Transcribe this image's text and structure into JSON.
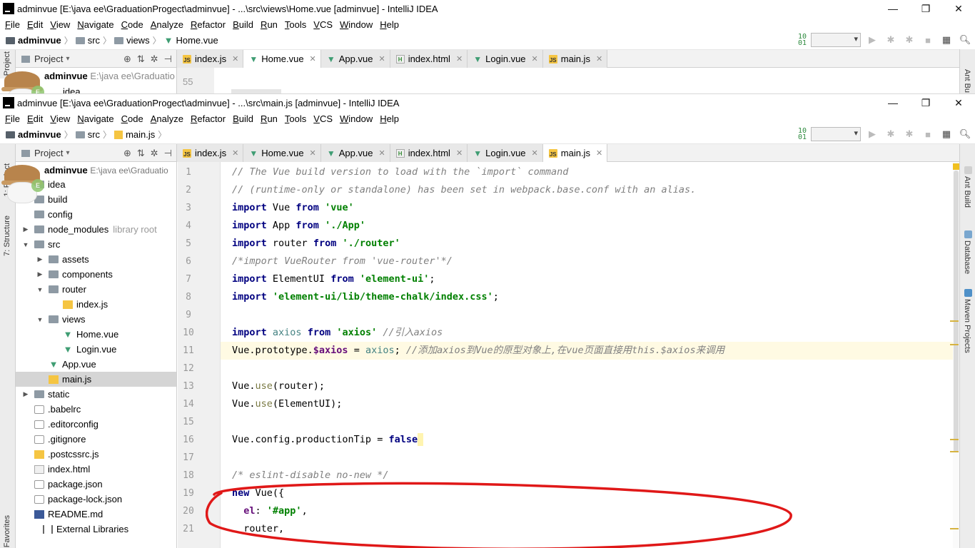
{
  "back_window": {
    "title": "adminvue [E:\\java ee\\GraduationProgect\\adminvue] - ...\\src\\views\\Home.vue [adminvue] - IntelliJ IDEA",
    "menu": [
      "File",
      "Edit",
      "View",
      "Navigate",
      "Code",
      "Analyze",
      "Refactor",
      "Build",
      "Run",
      "Tools",
      "VCS",
      "Window",
      "Help"
    ],
    "breadcrumb": [
      "adminvue",
      "src",
      "views",
      "Home.vue"
    ],
    "project_label": "Project",
    "tabs": [
      "index.js",
      "Home.vue",
      "App.vue",
      "index.html",
      "Login.vue",
      "main.js"
    ],
    "active_tab": "Home.vue",
    "project_root": "adminvue",
    "project_root_path": "E:\\java ee\\Graduatio",
    "first_child": "idea",
    "visible_line": "55",
    "right_label": "Ant Bu"
  },
  "front_window": {
    "title": "adminvue [E:\\java ee\\GraduationProgect\\adminvue] - ...\\src\\main.js [adminvue] - IntelliJ IDEA",
    "menu": [
      "File",
      "Edit",
      "View",
      "Navigate",
      "Code",
      "Analyze",
      "Refactor",
      "Build",
      "Run",
      "Tools",
      "VCS",
      "Window",
      "Help"
    ],
    "breadcrumb": [
      "adminvue",
      "src",
      "main.js"
    ],
    "project_label": "Project",
    "tabs": [
      {
        "label": "index.js",
        "type": "js"
      },
      {
        "label": "Home.vue",
        "type": "vue"
      },
      {
        "label": "App.vue",
        "type": "vue"
      },
      {
        "label": "index.html",
        "type": "html"
      },
      {
        "label": "Login.vue",
        "type": "vue"
      },
      {
        "label": "main.js",
        "type": "js"
      }
    ],
    "active_tab": "main.js",
    "left_stripe": {
      "project": "1: Project",
      "structure": "7: Structure",
      "favorites": "2: Favorites"
    },
    "right_stripe": {
      "ant": "Ant Build",
      "database": "Database",
      "maven": "Maven Projects"
    },
    "project_root": "adminvue",
    "project_root_path": "E:\\java ee\\Graduatio",
    "tree": [
      {
        "label": "idea",
        "type": "folder",
        "depth": 1,
        "arrow": ""
      },
      {
        "label": "build",
        "type": "folder",
        "depth": 1,
        "arrow": ""
      },
      {
        "label": "config",
        "type": "folder",
        "depth": 1,
        "arrow": ""
      },
      {
        "label": "node_modules",
        "type": "folder",
        "depth": 1,
        "arrow": ">",
        "extra": "library root"
      },
      {
        "label": "src",
        "type": "folder",
        "depth": 1,
        "arrow": "v"
      },
      {
        "label": "assets",
        "type": "folder",
        "depth": 2,
        "arrow": ">"
      },
      {
        "label": "components",
        "type": "folder",
        "depth": 2,
        "arrow": ">"
      },
      {
        "label": "router",
        "type": "folder",
        "depth": 2,
        "arrow": "v"
      },
      {
        "label": "index.js",
        "type": "js",
        "depth": 3,
        "arrow": ""
      },
      {
        "label": "views",
        "type": "folder",
        "depth": 2,
        "arrow": "v"
      },
      {
        "label": "Home.vue",
        "type": "vue",
        "depth": 3,
        "arrow": ""
      },
      {
        "label": "Login.vue",
        "type": "vue",
        "depth": 3,
        "arrow": ""
      },
      {
        "label": "App.vue",
        "type": "vue",
        "depth": 2,
        "arrow": ""
      },
      {
        "label": "main.js",
        "type": "js",
        "depth": 2,
        "arrow": "",
        "selected": true
      },
      {
        "label": "static",
        "type": "folder",
        "depth": 1,
        "arrow": ">"
      },
      {
        "label": ".babelrc",
        "type": "cfg",
        "depth": 1,
        "arrow": ""
      },
      {
        "label": ".editorconfig",
        "type": "cfg",
        "depth": 1,
        "arrow": ""
      },
      {
        "label": ".gitignore",
        "type": "cfg",
        "depth": 1,
        "arrow": ""
      },
      {
        "label": ".postcssrc.js",
        "type": "js",
        "depth": 1,
        "arrow": ""
      },
      {
        "label": "index.html",
        "type": "html",
        "depth": 1,
        "arrow": ""
      },
      {
        "label": "package.json",
        "type": "cfg",
        "depth": 1,
        "arrow": ""
      },
      {
        "label": "package-lock.json",
        "type": "cfg",
        "depth": 1,
        "arrow": ""
      },
      {
        "label": "README.md",
        "type": "md",
        "depth": 1,
        "arrow": ""
      },
      {
        "label": "External Libraries",
        "type": "lib",
        "depth": 0,
        "arrow": ""
      }
    ],
    "code": [
      {
        "n": "1",
        "t": [
          [
            "cm",
            "// The Vue build version to load with the `import` command"
          ]
        ]
      },
      {
        "n": "2",
        "t": [
          [
            "cm",
            "// (runtime-only or standalone) has been set in webpack.base.conf with an alias."
          ]
        ]
      },
      {
        "n": "3",
        "t": [
          [
            "kw",
            "import"
          ],
          [
            "",
            " Vue "
          ],
          [
            "kw",
            "from"
          ],
          [
            "",
            " "
          ],
          [
            "str",
            "'vue'"
          ]
        ]
      },
      {
        "n": "4",
        "t": [
          [
            "kw",
            "import"
          ],
          [
            "",
            " App "
          ],
          [
            "kw",
            "from"
          ],
          [
            "",
            " "
          ],
          [
            "str",
            "'./App'"
          ]
        ]
      },
      {
        "n": "5",
        "t": [
          [
            "kw",
            "import"
          ],
          [
            "",
            " router "
          ],
          [
            "kw",
            "from"
          ],
          [
            "",
            " "
          ],
          [
            "str",
            "'./router'"
          ]
        ]
      },
      {
        "n": "6",
        "t": [
          [
            "cm",
            "/*import VueRouter from 'vue-router'*/"
          ]
        ]
      },
      {
        "n": "7",
        "t": [
          [
            "kw",
            "import"
          ],
          [
            "",
            " ElementUI "
          ],
          [
            "kw",
            "from"
          ],
          [
            "",
            " "
          ],
          [
            "str",
            "'element-ui'"
          ],
          [
            "",
            ";"
          ]
        ]
      },
      {
        "n": "8",
        "t": [
          [
            "kw",
            "import"
          ],
          [
            "",
            " "
          ],
          [
            "str",
            "'element-ui/lib/theme-chalk/index.css'"
          ],
          [
            "",
            ";"
          ]
        ]
      },
      {
        "n": "9",
        "t": []
      },
      {
        "n": "10",
        "t": [
          [
            "kw",
            "import"
          ],
          [
            "var",
            " axios "
          ],
          [
            "kw",
            "from"
          ],
          [
            "",
            " "
          ],
          [
            "str",
            "'axios'"
          ],
          [
            "",
            " "
          ],
          [
            "cm",
            "//引入axios"
          ]
        ]
      },
      {
        "n": "11",
        "t": [
          [
            "",
            "Vue.prototype."
          ],
          [
            "prop",
            "$axios"
          ],
          [
            "",
            " = "
          ],
          [
            "var",
            "axios"
          ],
          [
            "",
            "; "
          ],
          [
            "cm",
            "//添加axios到Vue的原型对象上,在vue页面直接用this.$axios来调用"
          ]
        ],
        "current": true
      },
      {
        "n": "12",
        "t": []
      },
      {
        "n": "13",
        "t": [
          [
            "",
            "Vue."
          ],
          [
            "fn",
            "use"
          ],
          [
            "",
            "(router);"
          ]
        ]
      },
      {
        "n": "14",
        "t": [
          [
            "",
            "Vue."
          ],
          [
            "fn",
            "use"
          ],
          [
            "",
            "(ElementUI);"
          ]
        ]
      },
      {
        "n": "15",
        "t": []
      },
      {
        "n": "16",
        "t": [
          [
            "",
            "Vue.config.productionTip = "
          ],
          [
            "kw",
            "false"
          ]
        ]
      },
      {
        "n": "17",
        "t": []
      },
      {
        "n": "18",
        "t": [
          [
            "cm",
            "/* eslint-disable no-new */"
          ]
        ]
      },
      {
        "n": "19",
        "t": [
          [
            "kw",
            "new"
          ],
          [
            "",
            " Vue({"
          ]
        ]
      },
      {
        "n": "20",
        "t": [
          [
            "",
            "  "
          ],
          [
            "prop",
            "el"
          ],
          [
            "",
            ": "
          ],
          [
            "str",
            "'#app'"
          ],
          [
            "",
            ","
          ]
        ]
      },
      {
        "n": "21",
        "t": [
          [
            "",
            "  router,"
          ]
        ]
      }
    ]
  },
  "colors": {
    "annotation": "#e01818",
    "vue_icon": "#3f9d73",
    "keyword": "#000080",
    "string": "#008000",
    "comment": "#808080"
  }
}
